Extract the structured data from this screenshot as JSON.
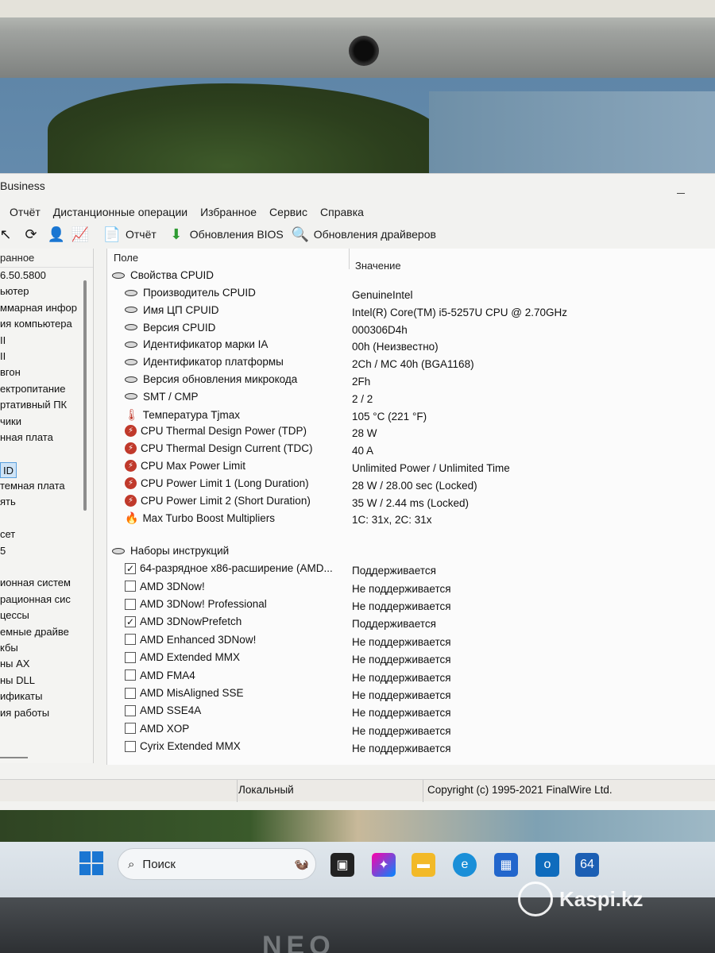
{
  "window": {
    "title": "Business"
  },
  "menu": [
    "Отчёт",
    "Дистанционные операции",
    "Избранное",
    "Сервис",
    "Справка"
  ],
  "toolbar": {
    "report_label": "Отчёт",
    "bios_label": "Обновления BIOS",
    "drivers_label": "Обновления драйверов"
  },
  "left_pane": {
    "header": "ранное",
    "items": [
      "6.50.5800",
      "ьютер",
      "ммарная инфор",
      "ия компьютера",
      "II",
      "II",
      "вгон",
      "ектропитание",
      "ртативный ПК",
      "чики",
      "нная плата",
      "",
      "ID",
      "темная плата",
      "ять",
      "",
      "сет",
      "5",
      "",
      "ионная систем",
      "рационная сис",
      "цессы",
      "емные драйве",
      "кбы",
      "ны AX",
      "ны DLL",
      "ификаты",
      "ия работы"
    ]
  },
  "columns": {
    "field": "Поле",
    "value": "Значение"
  },
  "cpuid": {
    "group": "Свойства CPUID",
    "rows": [
      {
        "field": "Производитель CPUID",
        "value": "GenuineIntel",
        "icon": "chip-icon"
      },
      {
        "field": "Имя ЦП CPUID",
        "value": "Intel(R) Core(TM) i5-5257U CPU @ 2.70GHz",
        "icon": "chip-icon"
      },
      {
        "field": "Версия CPUID",
        "value": "000306D4h",
        "icon": "chip-icon"
      },
      {
        "field": "Идентификатор марки IA",
        "value": "00h  (Неизвестно)",
        "icon": "chip-icon"
      },
      {
        "field": "Идентификатор платформы",
        "value": "2Ch / MC 40h  (BGA1168)",
        "icon": "chip-icon"
      },
      {
        "field": "Версия обновления микрокода",
        "value": "2Fh",
        "icon": "chip-icon"
      },
      {
        "field": "SMT / CMP",
        "value": "2 / 2",
        "icon": "chip-icon"
      },
      {
        "field": "Температура Tjmax",
        "value": "105 °C  (221 °F)",
        "icon": "thermometer-icon"
      },
      {
        "field": "CPU Thermal Design Power (TDP)",
        "value": "28 W",
        "icon": "power-icon"
      },
      {
        "field": "CPU Thermal Design Current (TDC)",
        "value": "40 A",
        "icon": "power-icon"
      },
      {
        "field": "CPU Max Power Limit",
        "value": "Unlimited Power / Unlimited Time",
        "icon": "power-icon"
      },
      {
        "field": "CPU Power Limit 1 (Long Duration)",
        "value": "28 W / 28.00 sec  (Locked)",
        "icon": "power-icon"
      },
      {
        "field": "CPU Power Limit 2 (Short Duration)",
        "value": "35 W / 2.44 ms  (Locked)",
        "icon": "power-icon"
      },
      {
        "field": "Max Turbo Boost Multipliers",
        "value": "1C: 31x, 2C: 31x",
        "icon": "turbo-icon"
      }
    ]
  },
  "instructions": {
    "group": "Наборы инструкций",
    "rows": [
      {
        "field": "64-разрядное x86-расширение (AMD...",
        "value": "Поддерживается",
        "checked": true
      },
      {
        "field": "AMD 3DNow!",
        "value": "Не поддерживается",
        "checked": false
      },
      {
        "field": "AMD 3DNow! Professional",
        "value": "Не поддерживается",
        "checked": false
      },
      {
        "field": "AMD 3DNowPrefetch",
        "value": "Поддерживается",
        "checked": true
      },
      {
        "field": "AMD Enhanced 3DNow!",
        "value": "Не поддерживается",
        "checked": false
      },
      {
        "field": "AMD Extended MMX",
        "value": "Не поддерживается",
        "checked": false
      },
      {
        "field": "AMD FMA4",
        "value": "Не поддерживается",
        "checked": false
      },
      {
        "field": "AMD MisAligned SSE",
        "value": "Не поддерживается",
        "checked": false
      },
      {
        "field": "AMD SSE4A",
        "value": "Не поддерживается",
        "checked": false
      },
      {
        "field": "AMD XOP",
        "value": "Не поддерживается",
        "checked": false
      },
      {
        "field": "Cyrix Extended MMX",
        "value": "Не поддерживается",
        "checked": false
      }
    ]
  },
  "status": {
    "mode": "Локальный",
    "copyright": "Copyright (c) 1995-2021 FinalWire Ltd."
  },
  "taskbar": {
    "search_label": "Поиск",
    "aida_badge": "64"
  },
  "watermark": "Kaspi.kz",
  "brand": "NEO"
}
